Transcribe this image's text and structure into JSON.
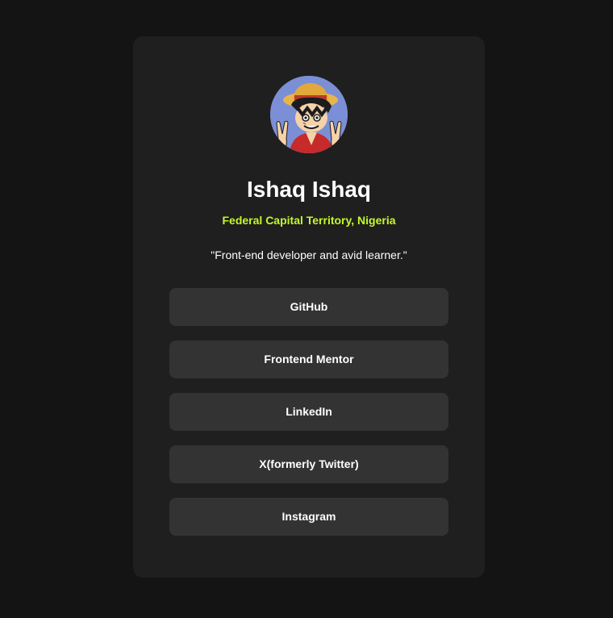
{
  "profile": {
    "name": "Ishaq Ishaq",
    "location": "Federal Capital Territory, Nigeria",
    "bio": "\"Front-end developer and avid learner.\"",
    "avatar_icon": "anime-character-avatar"
  },
  "links": [
    {
      "label": "GitHub"
    },
    {
      "label": "Frontend Mentor"
    },
    {
      "label": "LinkedIn"
    },
    {
      "label": "X(formerly Twitter)"
    },
    {
      "label": "Instagram"
    }
  ],
  "colors": {
    "page_background": "#141414",
    "card_background": "#1f1f1f",
    "button_background": "#333333",
    "accent": "#c4f82a",
    "text": "#ffffff"
  }
}
